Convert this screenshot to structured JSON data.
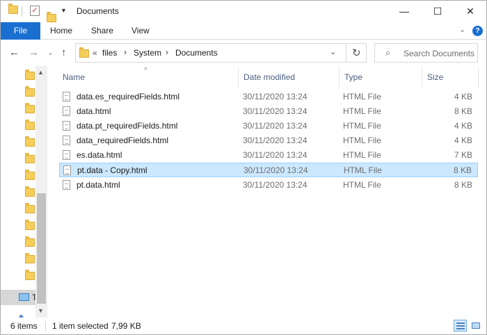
{
  "window": {
    "title": "Documents",
    "minimize": "—",
    "maximize": "☐",
    "close": "✕"
  },
  "ribbon": {
    "file": "File",
    "tabs": [
      "Home",
      "Share",
      "View"
    ],
    "expand": "⌄",
    "help": "?"
  },
  "address": {
    "overflow": "«",
    "crumbs": [
      "files",
      "System",
      "Documents"
    ],
    "separator": "›",
    "dropdown": "⌄",
    "refresh": "↻"
  },
  "search": {
    "placeholder": "Search Documents"
  },
  "nav": {
    "back": "←",
    "forward": "→",
    "recent": "⌄",
    "up": "↑",
    "this_pc_label": "T"
  },
  "columns": {
    "name": "Name",
    "date": "Date modified",
    "type": "Type",
    "size": "Size"
  },
  "files": [
    {
      "name": "data.es_requiredFields.html",
      "date": "30/11/2020 13:24",
      "type": "HTML File",
      "size": "4 KB",
      "selected": false
    },
    {
      "name": "data.html",
      "date": "30/11/2020 13:24",
      "type": "HTML File",
      "size": "8 KB",
      "selected": false
    },
    {
      "name": "data.pt_requiredFields.html",
      "date": "30/11/2020 13:24",
      "type": "HTML File",
      "size": "4 KB",
      "selected": false
    },
    {
      "name": "data_requiredFields.html",
      "date": "30/11/2020 13:24",
      "type": "HTML File",
      "size": "4 KB",
      "selected": false
    },
    {
      "name": "es.data.html",
      "date": "30/11/2020 13:24",
      "type": "HTML File",
      "size": "7 KB",
      "selected": false
    },
    {
      "name": "pt.data - Copy.html",
      "date": "30/11/2020 13:24",
      "type": "HTML File",
      "size": "8 KB",
      "selected": true
    },
    {
      "name": "pt.data.html",
      "date": "30/11/2020 13:24",
      "type": "HTML File",
      "size": "8 KB",
      "selected": false
    }
  ],
  "status": {
    "item_count": "6 items",
    "selection": "1 item selected",
    "selection_size": "7,99 KB"
  },
  "colors": {
    "accent": "#1a6fd1",
    "selection_bg": "#cce8ff",
    "selection_border": "#99d1ff",
    "folder": "#f5cf5a"
  }
}
